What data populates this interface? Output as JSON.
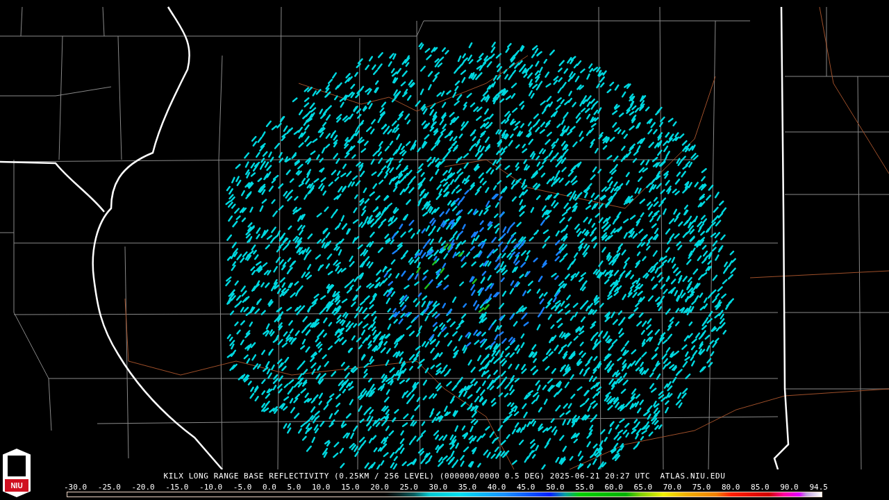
{
  "logo": {
    "text": "NIU"
  },
  "caption": "KILX LONG RANGE BASE REFLECTIVITY (0.25KM / 256 LEVEL) (000000/0000 0.5 DEG) 2025-06-21 20:27 UTC  ATLAS.NIU.EDU",
  "legend": {
    "ticks": [
      "-30.0",
      "-25.0",
      "-20.0",
      "-15.0",
      "-10.0",
      "-5.0",
      "0.0",
      "5.0",
      "10.0",
      "15.0",
      "20.0",
      "25.0",
      "30.0",
      "35.0",
      "40.0",
      "45.0",
      "50.0",
      "55.0",
      "60.0",
      "65.0",
      "70.0",
      "75.0",
      "80.0",
      "85.0",
      "90.0",
      "94.5"
    ]
  }
}
